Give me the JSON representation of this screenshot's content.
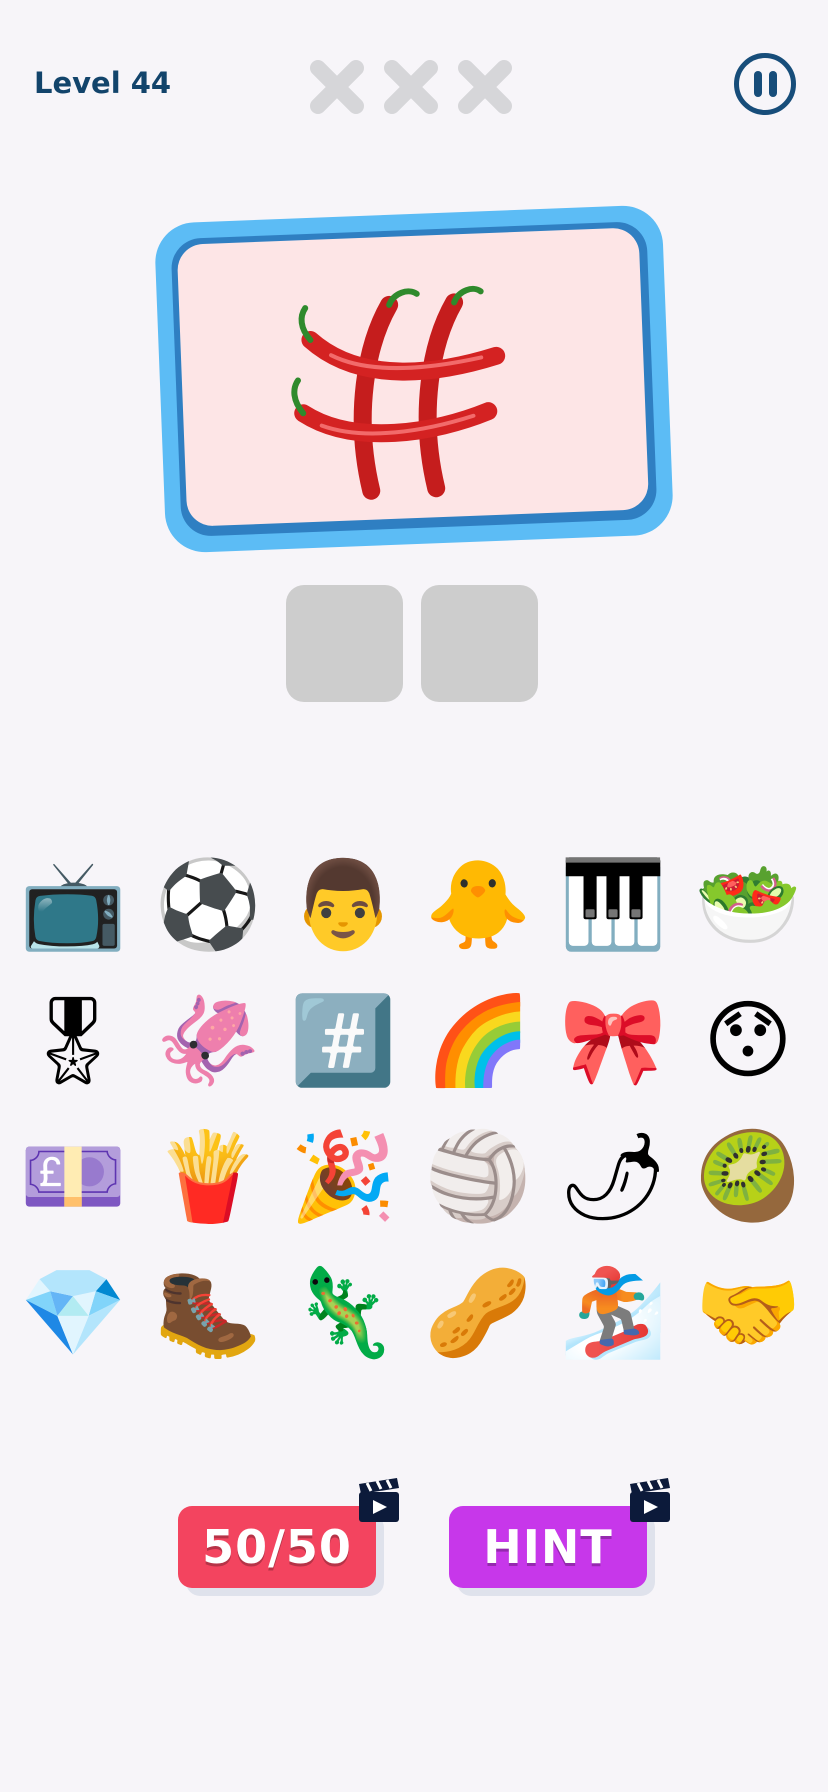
{
  "header": {
    "level_label": "Level 44",
    "strikes_total": 3,
    "strikes_used": 0,
    "pause_icon": "pause-icon"
  },
  "puzzle": {
    "clue_icon": "chili-peppers-hashtag",
    "answer_slots": 2
  },
  "emoji_grid": [
    {
      "icon": "television",
      "glyph": "📺"
    },
    {
      "icon": "soccer-ball",
      "glyph": "⚽"
    },
    {
      "icon": "man-face",
      "glyph": "👨"
    },
    {
      "icon": "baby-chick",
      "glyph": "🐥"
    },
    {
      "icon": "piano-keys",
      "glyph": "🎹"
    },
    {
      "icon": "green-salad",
      "glyph": "🥗"
    },
    {
      "icon": "military-medal",
      "glyph": "🎖"
    },
    {
      "icon": "squid",
      "glyph": "🦑"
    },
    {
      "icon": "hashtag-keycap",
      "glyph": "#️⃣"
    },
    {
      "icon": "rainbow",
      "glyph": "🌈"
    },
    {
      "icon": "ribbon-bow",
      "glyph": "🎀"
    },
    {
      "icon": "hushed-face",
      "glyph": "😯"
    },
    {
      "icon": "pound-banknote",
      "glyph": "💷"
    },
    {
      "icon": "french-fries",
      "glyph": "🍟"
    },
    {
      "icon": "party-popper",
      "glyph": "🎉"
    },
    {
      "icon": "volleyball",
      "glyph": "🏐"
    },
    {
      "icon": "hot-pepper",
      "glyph": "🌶"
    },
    {
      "icon": "kiwi-fruit",
      "glyph": "🥝"
    },
    {
      "icon": "gem-stone",
      "glyph": "💎"
    },
    {
      "icon": "hiking-boot",
      "glyph": "🥾"
    },
    {
      "icon": "lizard",
      "glyph": "🦎"
    },
    {
      "icon": "peanuts",
      "glyph": "🥜"
    },
    {
      "icon": "snowboarder",
      "glyph": "🏂"
    },
    {
      "icon": "handshake",
      "glyph": "🤝"
    }
  ],
  "buttons": {
    "fifty_fifty_label": "50/50",
    "hint_label": "HINT",
    "video_icon": "clapperboard-play-icon"
  },
  "colors": {
    "fifty_fifty": "#f3445f",
    "hint": "#c737ea",
    "card_border": "#5cbcf5",
    "card_face": "#fde5e6",
    "level_text": "#12446b"
  }
}
